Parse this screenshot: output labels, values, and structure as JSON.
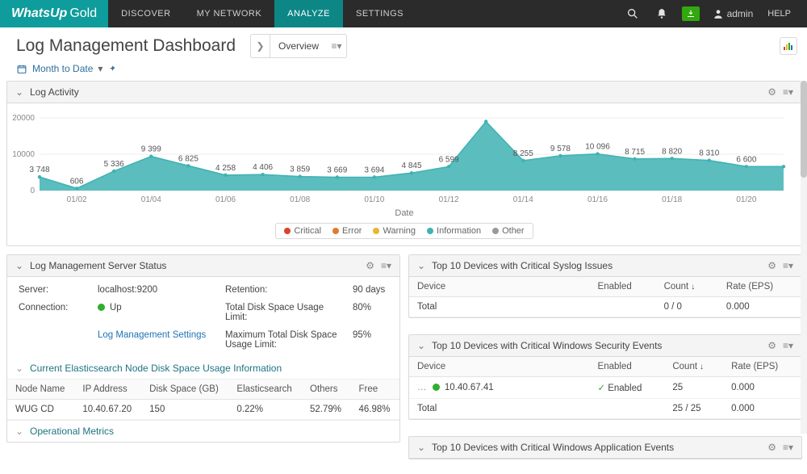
{
  "brand": {
    "name": "WhatsUp",
    "suffix": "Gold"
  },
  "topnav": [
    {
      "label": "DISCOVER"
    },
    {
      "label": "MY NETWORK"
    },
    {
      "label": "ANALYZE",
      "active": true
    },
    {
      "label": "SETTINGS"
    }
  ],
  "user": {
    "name": "admin"
  },
  "help": "HELP",
  "page": {
    "title": "Log Management Dashboard",
    "tab": "Overview"
  },
  "date_filter": {
    "label": "Month to Date"
  },
  "panels": {
    "log_activity": {
      "title": "Log Activity",
      "xlabel": "Date"
    },
    "server_status": {
      "title": "Log Management Server Status",
      "server_lbl": "Server:",
      "server_val": "localhost:9200",
      "conn_lbl": "Connection:",
      "conn_val": "Up",
      "retention_lbl": "Retention:",
      "retention_val": "90 days",
      "tdsl_lbl": "Total Disk Space Usage Limit:",
      "tdsl_val": "80%",
      "mtdsl_lbl": "Maximum Total Disk Space Usage Limit:",
      "mtdsl_val": "95%",
      "settings_link": "Log Management Settings",
      "es_section": "Current Elasticsearch Node Disk Space Usage Information",
      "es_headers": {
        "node": "Node Name",
        "ip": "IP Address",
        "disk": "Disk Space (GB)",
        "es": "Elasticsearch",
        "others": "Others",
        "free": "Free"
      },
      "es_row": {
        "node": "WUG CD",
        "ip": "10.40.67.20",
        "disk": "150",
        "es": "0.22%",
        "others": "52.79%",
        "free": "46.98%"
      },
      "op_metrics": "Operational Metrics"
    },
    "syslog": {
      "title": "Top 10 Devices with Critical Syslog Issues",
      "headers": {
        "device": "Device",
        "enabled": "Enabled",
        "count": "Count",
        "rate": "Rate (EPS)"
      },
      "total": {
        "device": "Total",
        "count": "0 / 0",
        "rate": "0.000"
      }
    },
    "winsec": {
      "title": "Top 10 Devices with Critical Windows Security Events",
      "headers": {
        "device": "Device",
        "enabled": "Enabled",
        "count": "Count",
        "rate": "Rate (EPS)"
      },
      "row": {
        "device": "10.40.67.41",
        "enabled": "Enabled",
        "count": "25",
        "rate": "0.000"
      },
      "total": {
        "device": "Total",
        "count": "25 / 25",
        "rate": "0.000"
      }
    },
    "winapp": {
      "title": "Top 10 Devices with Critical Windows Application Events"
    }
  },
  "legend": [
    {
      "label": "Critical",
      "color": "#d9432f"
    },
    {
      "label": "Error",
      "color": "#e07b2f"
    },
    {
      "label": "Warning",
      "color": "#e9b62f"
    },
    {
      "label": "Information",
      "color": "#3fb2b3"
    },
    {
      "label": "Other",
      "color": "#9a9a9a"
    }
  ],
  "chart_data": {
    "type": "area",
    "title": "Log Activity",
    "xlabel": "Date",
    "ylabel": "",
    "ylim": [
      0,
      20000
    ],
    "yticks": [
      0,
      10000,
      20000
    ],
    "x": [
      "01/01",
      "01/02",
      "01/03",
      "01/04",
      "01/05",
      "01/06",
      "01/07",
      "01/08",
      "01/09",
      "01/10",
      "01/11",
      "01/12",
      "01/13",
      "01/14",
      "01/15",
      "01/16",
      "01/17",
      "01/18",
      "01/19",
      "01/20",
      "01/21"
    ],
    "xticks": [
      "01/02",
      "01/04",
      "01/06",
      "01/08",
      "01/10",
      "01/12",
      "01/14",
      "01/16",
      "01/18",
      "01/20"
    ],
    "series": [
      {
        "name": "Information",
        "color": "#3fb2b3",
        "values": [
          3748,
          606,
          5336,
          9399,
          6825,
          4258,
          4406,
          3859,
          3669,
          3694,
          4845,
          6599,
          19000,
          8255,
          9578,
          10096,
          8715,
          8820,
          8310,
          6600,
          6600
        ],
        "labels": [
          3748,
          606,
          5336,
          9399,
          6825,
          4258,
          4406,
          3859,
          3669,
          3694,
          4845,
          6599,
          null,
          8255,
          9578,
          10096,
          8715,
          8820,
          8310,
          6600,
          null
        ]
      }
    ],
    "legend": [
      "Critical",
      "Error",
      "Warning",
      "Information",
      "Other"
    ]
  }
}
